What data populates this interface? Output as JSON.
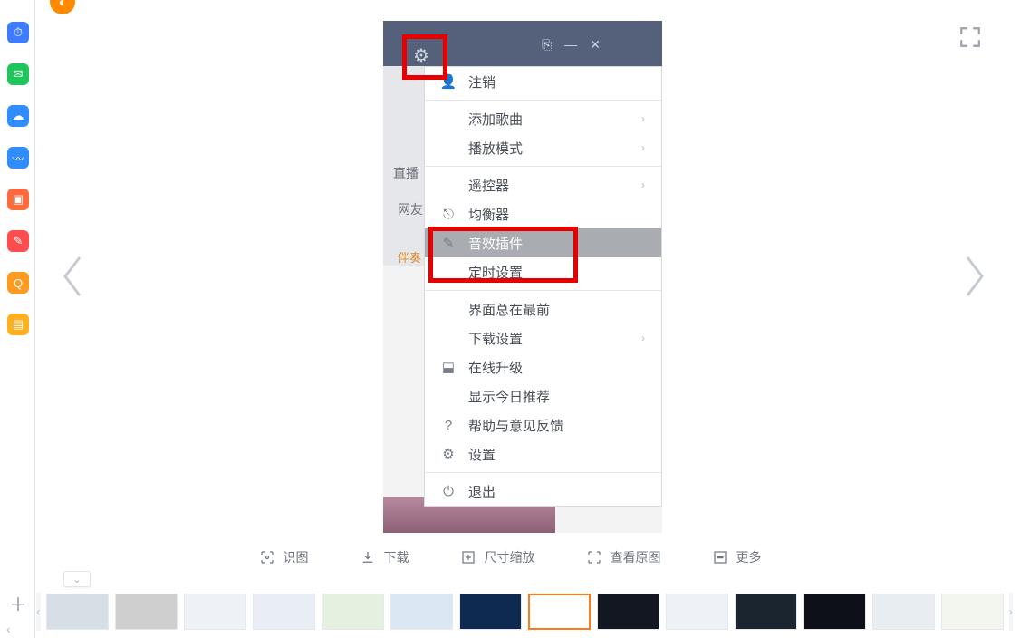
{
  "sidebar_icons": [
    {
      "name": "clock-icon",
      "bg": "#3d7bff",
      "glyph": "⏱"
    },
    {
      "name": "wechat-icon",
      "bg": "#1fc65c",
      "glyph": "✉"
    },
    {
      "name": "cloud-icon",
      "bg": "#2f8dff",
      "glyph": "☁"
    },
    {
      "name": "wave-icon",
      "bg": "#2f8dff",
      "glyph": "〰"
    },
    {
      "name": "image-icon",
      "bg": "#ff6a3c",
      "glyph": "▣"
    },
    {
      "name": "pdf-icon",
      "bg": "#ff4d4d",
      "glyph": "✎"
    },
    {
      "name": "search-orange-icon",
      "bg": "#ff9a1f",
      "glyph": "Q"
    },
    {
      "name": "note-icon",
      "bg": "#ffb01f",
      "glyph": "▤"
    }
  ],
  "menu": {
    "items": [
      {
        "name": "logout",
        "icon": "👤",
        "label": "注销",
        "chev": false,
        "sel": false
      },
      {
        "sep": true
      },
      {
        "name": "add-song",
        "icon": "",
        "label": "添加歌曲",
        "chev": true,
        "sel": false
      },
      {
        "name": "play-mode",
        "icon": "",
        "label": "播放模式",
        "chev": true,
        "sel": false
      },
      {
        "sep": true
      },
      {
        "name": "remote",
        "icon": "",
        "label": "遥控器",
        "chev": true,
        "sel": false
      },
      {
        "name": "equalizer",
        "icon": "⎋",
        "label": "均衡器",
        "chev": false,
        "sel": false
      },
      {
        "name": "audio-plugin",
        "icon": "✎",
        "label": "音效插件",
        "chev": false,
        "sel": true
      },
      {
        "name": "timer",
        "icon": "",
        "label": "定时设置",
        "chev": false,
        "sel": false
      },
      {
        "sep": true
      },
      {
        "name": "always-on-top",
        "icon": "",
        "label": "界面总在最前",
        "chev": false,
        "sel": false
      },
      {
        "name": "download-settings",
        "icon": "",
        "label": "下载设置",
        "chev": true,
        "sel": false
      },
      {
        "name": "online-upgrade",
        "icon": "⬓",
        "label": "在线升级",
        "chev": false,
        "sel": false
      },
      {
        "name": "show-today",
        "icon": "",
        "label": "显示今日推荐",
        "chev": false,
        "sel": false
      },
      {
        "name": "help-feedback",
        "icon": "?",
        "label": "帮助与意见反馈",
        "chev": false,
        "sel": false
      },
      {
        "name": "settings",
        "icon": "⚙",
        "label": "设置",
        "chev": false,
        "sel": false
      },
      {
        "sep": true
      },
      {
        "name": "exit",
        "icon": "⏻",
        "label": "退出",
        "chev": false,
        "sel": false
      }
    ]
  },
  "app_labels": {
    "l1": "直播",
    "l2": "网友",
    "l3": "伴奏"
  },
  "actions": {
    "recognize": "识图",
    "download": "下载",
    "resize": "尺寸缩放",
    "view_original": "查看原图",
    "more": "更多"
  },
  "thumbs": {
    "count": 14,
    "active_index": 7
  }
}
